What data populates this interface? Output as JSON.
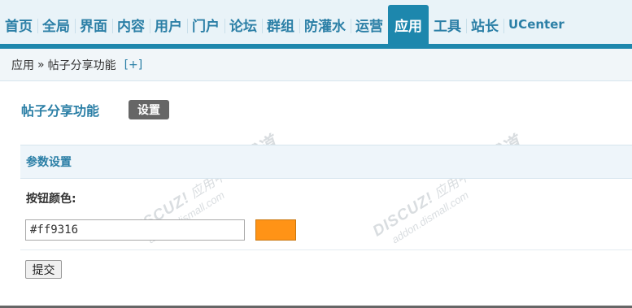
{
  "nav": {
    "items": [
      {
        "label": "首页"
      },
      {
        "label": "全局"
      },
      {
        "label": "界面"
      },
      {
        "label": "内容"
      },
      {
        "label": "用户"
      },
      {
        "label": "门户"
      },
      {
        "label": "论坛"
      },
      {
        "label": "群组"
      },
      {
        "label": "防灌水"
      },
      {
        "label": "运营"
      },
      {
        "label": "应用"
      },
      {
        "label": "工具"
      },
      {
        "label": "站长"
      },
      {
        "label": "UCenter"
      }
    ],
    "active_index": 10
  },
  "breadcrumb": {
    "root": "应用",
    "separator": "»",
    "current": "帖子分享功能",
    "add_label": "[+]"
  },
  "page": {
    "title": "帖子分享功能",
    "settings_label": "设置"
  },
  "section": {
    "title": "参数设置"
  },
  "form": {
    "color_label": "按钮颜色:",
    "color_value": "#ff9316",
    "swatch_color": "#ff9316",
    "submit_label": "提交"
  },
  "watermark": {
    "brand": "DISCUZ!应用中心",
    "url": "addon.dismall.com",
    "mark": "贰道"
  },
  "colors": {
    "accent": "#1d87ad",
    "link": "#2b7fa6"
  }
}
